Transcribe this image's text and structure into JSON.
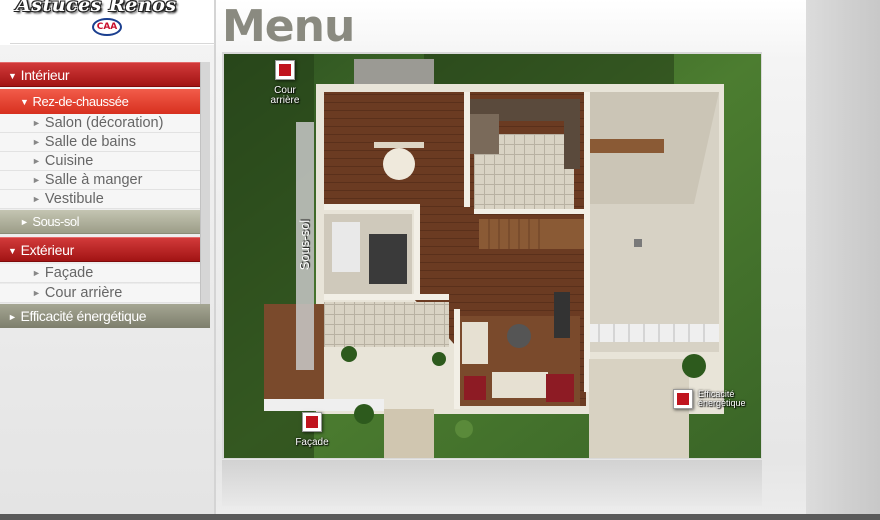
{
  "logo": {
    "text": "Astuces Rénos",
    "badge": "CAA"
  },
  "page": {
    "title": "Menu"
  },
  "menu": {
    "interior": {
      "label": "Intérieur"
    },
    "ground_floor": {
      "label": "Rez-de-chaussée"
    },
    "ground_floor_items": [
      {
        "label": "Salon (décoration)"
      },
      {
        "label": "Salle de bains"
      },
      {
        "label": "Cuisine"
      },
      {
        "label": "Salle à manger"
      },
      {
        "label": "Vestibule"
      }
    ],
    "basement": {
      "label": "Sous-sol"
    },
    "exterior": {
      "label": "Extérieur"
    },
    "exterior_items": [
      {
        "label": "Façade"
      },
      {
        "label": "Cour arrière"
      }
    ],
    "energy": {
      "label": "Efficacité énergétique"
    }
  },
  "plan": {
    "hotspots": {
      "backyard": {
        "line1": "Cour",
        "line2": "arrière"
      },
      "facade": {
        "label": "Façade"
      },
      "energy": {
        "line1": "Efficacité",
        "line2": "énergétique"
      }
    },
    "basement_label": "Sous-sol"
  },
  "colors": {
    "menu_red": "#b01a1a",
    "menu_active": "#e8412f",
    "menu_grey": "#9c9d88",
    "hotspot_red": "#c0141e",
    "title_grey": "#8a8a80"
  }
}
